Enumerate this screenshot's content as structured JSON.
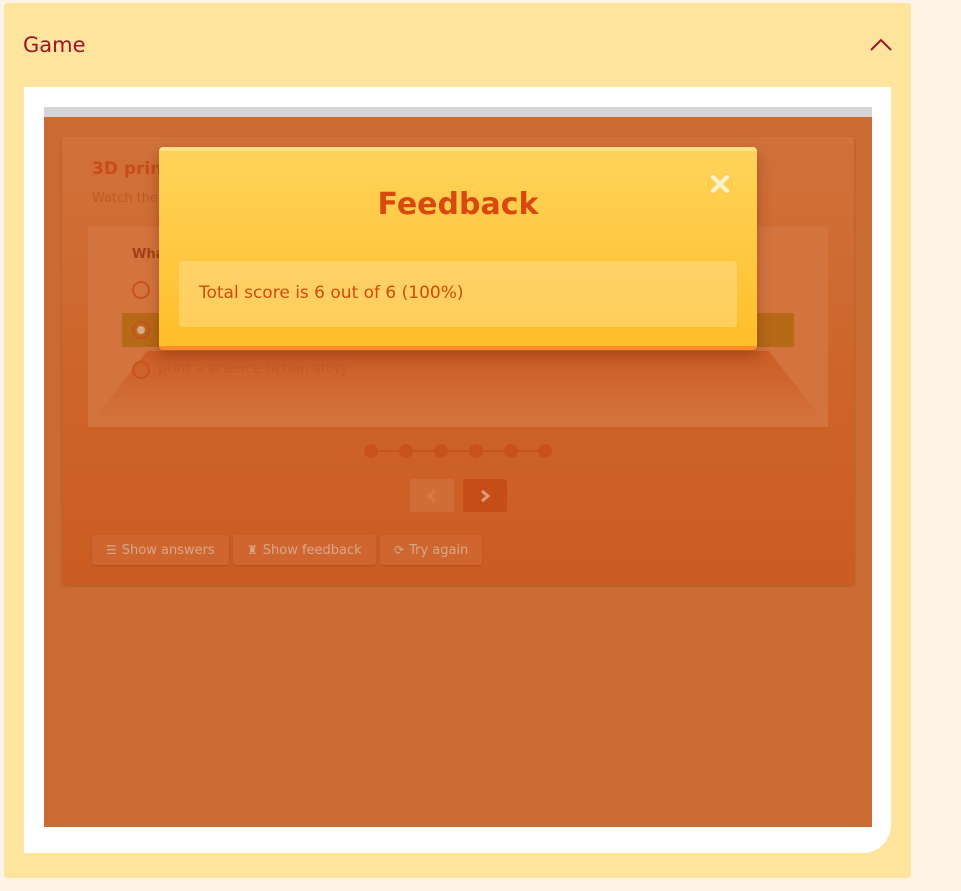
{
  "panel": {
    "title": "Game",
    "collapse_icon": "chevron-up-icon",
    "title_color": "#a1122a"
  },
  "game": {
    "title": "3D prin",
    "subtitle": "Watch the",
    "question": "Wha",
    "options": [
      {
        "label": "",
        "selected": false
      },
      {
        "label": "",
        "selected": true
      },
      {
        "label": "print a science fiction story",
        "selected": false
      }
    ],
    "progress": {
      "total": 6,
      "current": 6
    },
    "nav": {
      "prev_icon": "chevron-left-icon",
      "next_icon": "chevron-right-icon"
    },
    "actions": [
      {
        "label": "Show answers",
        "icon": "list-icon"
      },
      {
        "label": "Show feedback",
        "icon": "chess-rook-icon"
      },
      {
        "label": "Try again",
        "icon": "refresh-icon"
      }
    ]
  },
  "modal": {
    "title": "Feedback",
    "close_icon": "close-icon",
    "message": "Total score is 6 out of 6 (100%)",
    "accent": "#ffbe2a",
    "title_color": "#d9490f"
  }
}
